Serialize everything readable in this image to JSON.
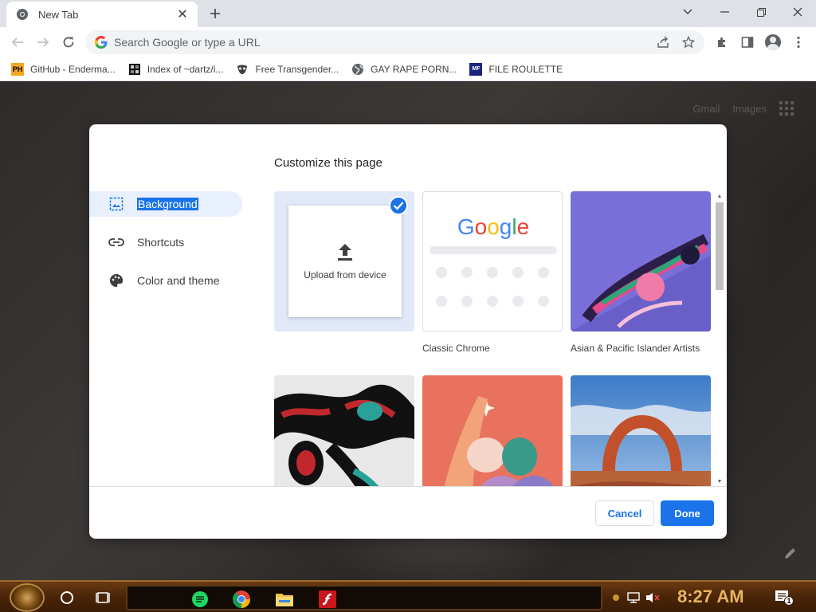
{
  "browser": {
    "tab": {
      "title": "New Tab",
      "icon": "chrome-icon"
    },
    "new_tab_icon": "plus-icon",
    "window_controls": [
      "chevron-down-icon",
      "minimize-icon",
      "restore-icon",
      "close-icon"
    ],
    "omnibox": {
      "placeholder": "Search Google or type a URL"
    },
    "bookmarks": [
      {
        "label": "GitHub - Enderma...",
        "icon": "ph-favicon",
        "icon_text": "PH"
      },
      {
        "label": "Index of ~dartz/i...",
        "icon": "folder-favicon"
      },
      {
        "label": "Free Transgender...",
        "icon": "mask-favicon"
      },
      {
        "label": "GAY RAPE PORN...",
        "icon": "globe-favicon"
      },
      {
        "label": "FILE ROULETTE",
        "icon": "mf-favicon",
        "icon_text": "MF"
      }
    ]
  },
  "page": {
    "top_links": [
      "Gmail",
      "Images"
    ],
    "apps_icon": "apps-grid-icon",
    "customize_icon": "pencil-icon"
  },
  "dialog": {
    "title": "Customize this page",
    "menu": [
      {
        "label": "Background",
        "icon": "image-icon",
        "active": true
      },
      {
        "label": "Shortcuts",
        "icon": "link-icon",
        "active": false
      },
      {
        "label": "Color and theme",
        "icon": "palette-icon",
        "active": false
      }
    ],
    "tiles": [
      {
        "label": "",
        "upload_label": "Upload from device",
        "selected": true
      },
      {
        "label": "Classic Chrome",
        "logo": "Google"
      },
      {
        "label": "Asian & Pacific Islander Artists"
      },
      {
        "label": ""
      },
      {
        "label": ""
      },
      {
        "label": ""
      }
    ],
    "cancel_label": "Cancel",
    "done_label": "Done"
  },
  "taskbar": {
    "clock": "8:27 AM",
    "notification_count": "1",
    "apps": [
      "sheets-icon",
      "chrome-icon",
      "file-explorer-icon",
      "flash-icon"
    ]
  },
  "colors": {
    "accent": "#1a73e8",
    "selected_bg": "#e8f0fe",
    "clock": "#e8b460"
  }
}
